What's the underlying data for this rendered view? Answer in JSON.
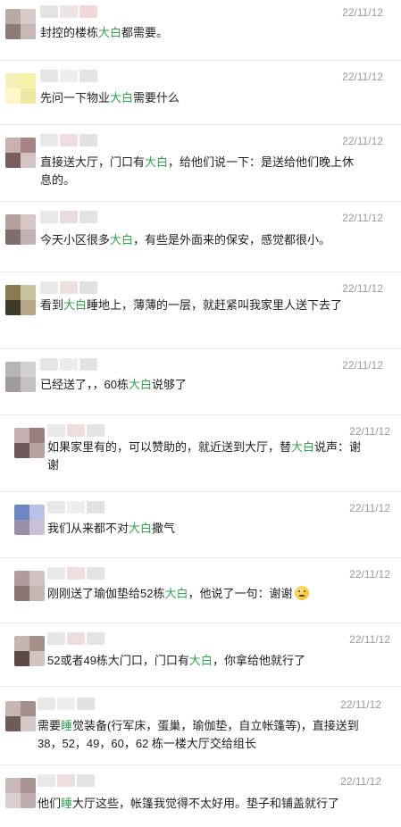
{
  "keyword": "大白",
  "keyword_color": "#2ea44f",
  "messages": [
    {
      "time": "22/11/12",
      "avatar_colors": [
        "#b9aaa6",
        "#d8ccc9",
        "#8f7b76",
        "#c7b8b5"
      ],
      "nick_colors": [
        "#e3e3e3",
        "#efe4e4",
        "#f2d7d9"
      ],
      "parts": [
        "封控的楼栋",
        "大白",
        "都需要。"
      ]
    },
    {
      "time": "22/11/12",
      "avatar_colors": [
        "#f4f0b8",
        "#f7f1a6",
        "#fff7c9",
        "#efe8a3"
      ],
      "nick_colors": [
        "#e6e6e6",
        "#eeeeee",
        "#e4e4e4"
      ],
      "parts": [
        "先问一下物业",
        "大白",
        "需要什么"
      ]
    },
    {
      "time": "22/11/12",
      "avatar_colors": [
        "#c9b0b3",
        "#a98486",
        "#7a5c5e",
        "#d4c4c5"
      ],
      "nick_colors": [
        "#e9e9e9",
        "#f0dde0",
        "#e2e2e2"
      ],
      "parts": [
        "直接送大厅，门口有",
        "大白",
        "，给他们说一下：是送给他们晚上休息的。"
      ]
    },
    {
      "time": "22/11/12",
      "avatar_colors": [
        "#b8a09f",
        "#d5c7c6",
        "#7f6c6b",
        "#c2b2b1"
      ],
      "nick_colors": [
        "#e8e8e8",
        "#eadcdc",
        "#e3e3e3"
      ],
      "parts": [
        "今天小区很多",
        "大白",
        "，有些是外面来的保安，感觉都很小。"
      ]
    },
    {
      "time": "22/11/12",
      "avatar_colors": [
        "#8a7a4e",
        "#c9c3a0",
        "#3e3a2a",
        "#b7a987"
      ],
      "nick_colors": [
        "#e9e9e9",
        "#efe0e0",
        "#e1e1e1"
      ],
      "parts": [
        "看到",
        "大白",
        "睡地上，薄薄的一层，就赶紧叫我家里人送下去了"
      ]
    },
    {
      "time": "22/11/12",
      "avatar_colors": [
        "#b9b4b4",
        "#d3cfcf",
        "#a39b9b",
        "#c5c1c1"
      ],
      "nick_colors": [
        "#e6e6e6",
        "#ececec",
        "#e3e3e3"
      ],
      "parts": [
        "已经送了，，60栋",
        "大白",
        "说够了"
      ]
    },
    {
      "time": "22/11/12",
      "avatar_colors": [
        "#c4b1b1",
        "#9a7e7e",
        "#6e5656",
        "#b8a2a2"
      ],
      "nick_colors": [
        "#e8e8e8",
        "#efdede",
        "#e4e4e4"
      ],
      "parts": [
        "如果家里有的，可以赞助的，就近送到大厅，替",
        "大白",
        "说声：谢谢"
      ]
    },
    {
      "time": "22/11/12",
      "avatar_colors": [
        "#6c86c8",
        "#b8c3e6",
        "#9a8fa8",
        "#c9c2d6"
      ],
      "nick_colors": [
        "#e7e7e7",
        "#eeeeee",
        "#e2e2e2"
      ],
      "parts": [
        "我们从来都不对",
        "大白",
        "撒气"
      ]
    },
    {
      "time": "22/11/12",
      "avatar_colors": [
        "#b19d9b",
        "#d0c2c0",
        "#8a7573",
        "#c6b7b5"
      ],
      "nick_colors": [
        "#e9e9e9",
        "#eee0e0",
        "#e3e3e3"
      ],
      "parts": [
        "刚刚送了瑜伽垫给52栋",
        "大白",
        "，他说了一句：谢谢"
      ],
      "emoji": "thinking-face-emoji"
    },
    {
      "time": "22/11/12",
      "avatar_colors": [
        "#c4b6b1",
        "#a59089",
        "#5e4a44",
        "#d1c5c1"
      ],
      "nick_colors": [
        "#e7e7e7",
        "#efdede",
        "#e4e4e4"
      ],
      "parts": [
        "52或者49栋大门口，门口有",
        "大白",
        "，你拿给他就行了"
      ]
    },
    {
      "time": "22/11/12",
      "avatar_colors": [
        "#c7b6b4",
        "#a58f8c",
        "#6f5b59",
        "#d5c9c8"
      ],
      "nick_colors": [
        "#e8e8e8",
        "#eeeeee",
        "#e2e2e2"
      ],
      "parts": [
        "需要",
        "睡",
        "觉装备(行军床，蛋巢，瑜伽垫，自立帐篷等)，直接送到38，52，49，60，62 栋一楼大厅交给组长"
      ]
    },
    {
      "time": "22/11/12",
      "avatar_colors": [
        "#c8b9b8",
        "#a89593",
        "#d9cfce",
        "#bcaeac"
      ],
      "nick_colors": [
        "#e8e8e8",
        "#efdede",
        "#e3e3e3"
      ],
      "parts": [
        "他们",
        "睡",
        "大厅这些，帐篷我觉得不太好用。垫子和铺盖就行了"
      ]
    }
  ]
}
